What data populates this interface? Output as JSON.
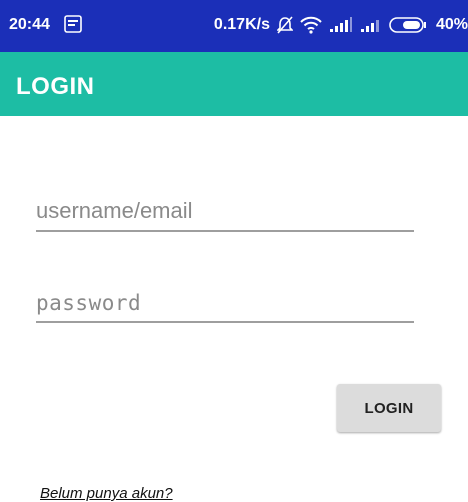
{
  "status_bar": {
    "time": "20:44",
    "network_speed": "0.17K/s",
    "battery": "40%",
    "icons": [
      "notification-icon",
      "alarm-off-icon",
      "wifi-icon",
      "signal-icon",
      "signal-icon",
      "battery-icon"
    ]
  },
  "app_bar": {
    "title": "LOGIN",
    "color": "#1dbda4"
  },
  "form": {
    "username_placeholder": "username/email",
    "password_placeholder": "password",
    "login_label": "LOGIN"
  },
  "register_link": "Belum punya akun?"
}
